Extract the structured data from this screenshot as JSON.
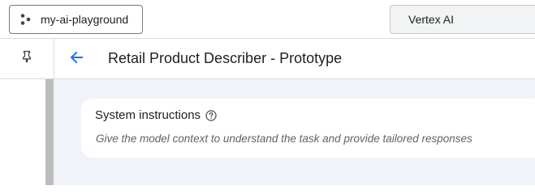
{
  "topbar": {
    "project_picker": {
      "label": "my-ai-playground",
      "icon": "project-dots-icon"
    },
    "search": {
      "value": "Vertex AI"
    }
  },
  "header": {
    "pin_icon": "pin-icon",
    "back_icon": "arrow-back-icon",
    "title": "Retail Product Describer - Prototype"
  },
  "system_instructions": {
    "title": "System instructions",
    "help_icon": "help-circle-icon",
    "placeholder": "Give the model context to understand the task and provide tailored responses"
  },
  "colors": {
    "accent": "#1a73e8",
    "main_background": "#f0f4f9",
    "scroll_strip": "#bdbdbd"
  }
}
